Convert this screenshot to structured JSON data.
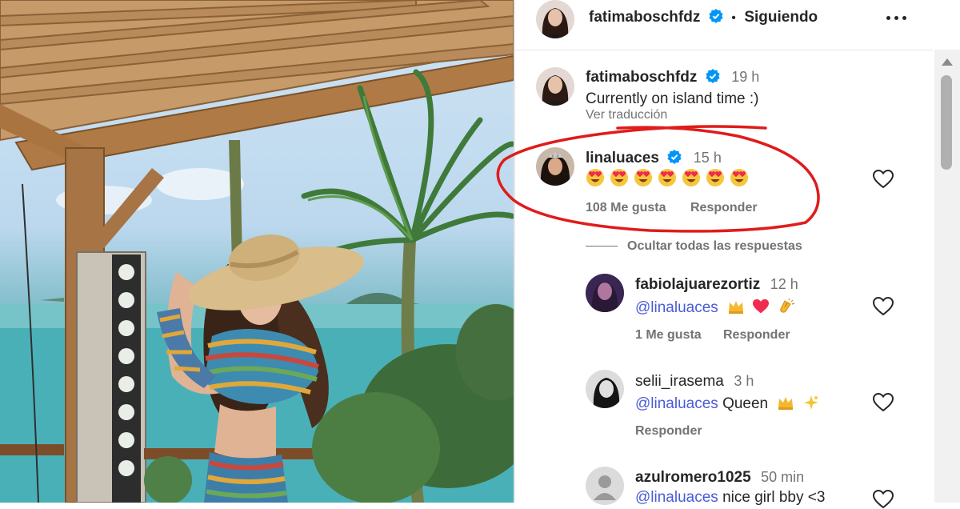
{
  "post": {
    "author": "fatimaboschfdz",
    "follow_state": "Siguiendo",
    "separator": "•"
  },
  "caption": {
    "username": "fatimaboschfdz",
    "time": "19 h",
    "text": "Currently on island time :)",
    "translate": "Ver traducción"
  },
  "comments": [
    {
      "username": "linaluaces",
      "time": "15 h",
      "verified": true,
      "emoji": "smiling-face-with-heart-eyes",
      "emoji_count": 7,
      "likes": "108 Me gusta",
      "reply": "Responder"
    }
  ],
  "hide_replies": "Ocultar todas las respuestas",
  "replies": [
    {
      "username": "fabiolajuarezortiz",
      "time": "12 h",
      "mention": "@linaluaces",
      "text": "",
      "icons": [
        "crown-icon",
        "heart-icon",
        "clapping-hands-icon"
      ],
      "likes": "1 Me gusta",
      "reply": "Responder"
    },
    {
      "username": "selii_irasema",
      "time": "3 h",
      "mention": "@linaluaces",
      "text": "Queen",
      "icons": [
        "crown-icon",
        "sparkles-icon"
      ],
      "likes": "",
      "reply": "Responder"
    },
    {
      "username": "azulromero1025",
      "time": "50 min",
      "mention": "@linaluaces",
      "text": "nice girl bby <3",
      "icons": [],
      "likes": "",
      "reply": ""
    }
  ],
  "colors": {
    "verified": "#0095f6",
    "mention": "#4a5cd6",
    "annotation": "#e01b1b",
    "heart_emoji": "#ef2b50"
  }
}
